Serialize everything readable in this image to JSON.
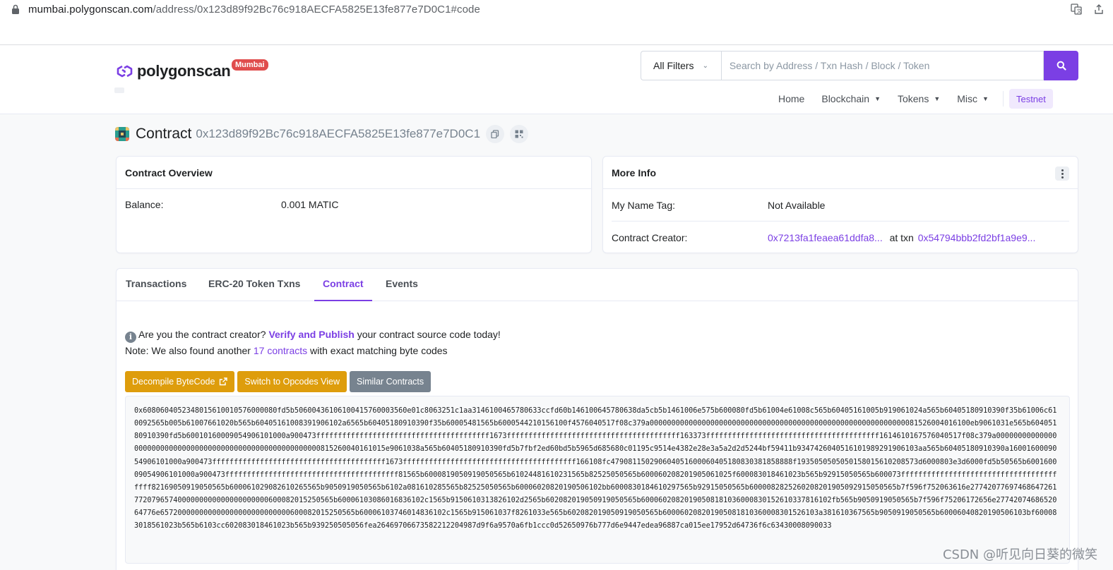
{
  "browser": {
    "url_host": "mumbai.polygonscan.com",
    "url_path": "/address/0x123d89f92Bc76c918AECFA5825E13fe877e7D0C1#code"
  },
  "site": {
    "logo_text": "polygonscan",
    "logo_badge": "Mumbai",
    "brand_color": "#7b3fe4"
  },
  "search": {
    "filter_label": "All Filters",
    "placeholder": "Search by Address / Txn Hash / Block / Token"
  },
  "nav": {
    "home": "Home",
    "blockchain": "Blockchain",
    "tokens": "Tokens",
    "misc": "Misc",
    "network": "Testnet"
  },
  "page": {
    "label": "Contract",
    "address": "0x123d89f92Bc76c918AECFA5825E13fe877e7D0C1"
  },
  "overview": {
    "title": "Contract Overview",
    "balance_label": "Balance:",
    "balance_value": "0.001 MATIC"
  },
  "more_info": {
    "title": "More Info",
    "name_tag_label": "My Name Tag:",
    "name_tag_value": "Not Available",
    "creator_label": "Contract Creator:",
    "creator_address": "0x7213fa1feaea61ddfa8...",
    "at_txn": "at txn",
    "creator_txn": "0x54794bbb2fd2bf1a9e9..."
  },
  "tabs": [
    {
      "label": "Transactions",
      "active": false
    },
    {
      "label": "ERC-20 Token Txns",
      "active": false
    },
    {
      "label": "Contract",
      "active": true
    },
    {
      "label": "Events",
      "active": false
    }
  ],
  "notice": {
    "q_prefix": "Are you the contract creator?",
    "verify_link": "Verify and Publish",
    "q_suffix": "your contract source code today!",
    "note_prefix": "Note: We also found another",
    "contracts_link": "17 contracts",
    "note_suffix": "with exact matching byte codes"
  },
  "buttons": {
    "decompile": "Decompile ByteCode",
    "opcodes": "Switch to Opcodes View",
    "similar": "Similar Contracts"
  },
  "bytecode": "0x6080604052348015610010576000080fd5b5060043610610041576000356​0e01c8063251c1aa3146100465780633ccfd60b146100645780638da5cb5b1461006e575b600080fd5b61004e61008c565b60405161005b919061024a565b60405180910390f35b61006c610092565b005b61007661020b565b6040516100839190610​2a6565b60405180910390f35b60005481565b6000544210156100f4576040517f08c379a000000000000000000000000000000000000000000000000000000000000815260040161​00eb9061031e565b60405180910390fd5b60010160009054906101000a900473ffffffffffffffffffffffffffffffffffffffff1673ffffffffffffffffffffffffffffffffffffffff163373ffffffffffffffffffffffffffffffffffffffff161461016757604051​7f08c379a0000000000000000000000000000000000000000000000000000000008152600401610​15e9061038a565b60405180910390fd5b7fbf2ed60bd5b5965d685680c01195c9514e4382e28e3a5a2d2d5244bf59411b934742604051610​1989291906103aa565b60405180910390a160016000905490610100​0a900473ffffffffffffffffffffffffffffffffffffffff1673ffffffffffffffffffffffffffffffffffffffff166108fc479081150290604051600060405180830381858888f19350505050501580156102085​73d6000803e3d6000fd5b50565b60016000905490610100​0a900473ffffffffffffffffffffffffffffffffffffffff81565b6000819050919050565b61024481610231565b82525050565b600060208201905061025f60008301846102​3b565b92915050565b600073ffffffffffffffffffffffffffffffffffffffff821690509190505​65b6000610290826102​65565b9050919050565b6102a08161028556​5b82525050565b600060208201905061​02bb600083018461029756​5b92915050565b6000082825260208201905092915050565b7f596f752063616e277420776974686472617720796574000000000000000000000600082015250​565b6000610308601683610​2c1565b915061031382610​2d2565b602082019050919050565b60006020820190508181036000830152610337816102fb565b9050919050565b7f596f75206172656e2774207468652064776e65720000000000000000000000000060008201525056​5b6000610374601483610​2c1565b91506103​7f8261033e565b602082019050919050565b600060208201905081810360008301526103a381610367565b9050919050565b60006040820190506103bf6000830185610​23b565b6103cc6020830184610​23b565b939250505056fea264697066735822122​04987d9f6a9570a6fb1ccc0d52650976b777d6e9447edea96887ca015ee17952d64736f6c63430008090033",
  "watermark": "CSDN @听见向日葵的微笑"
}
